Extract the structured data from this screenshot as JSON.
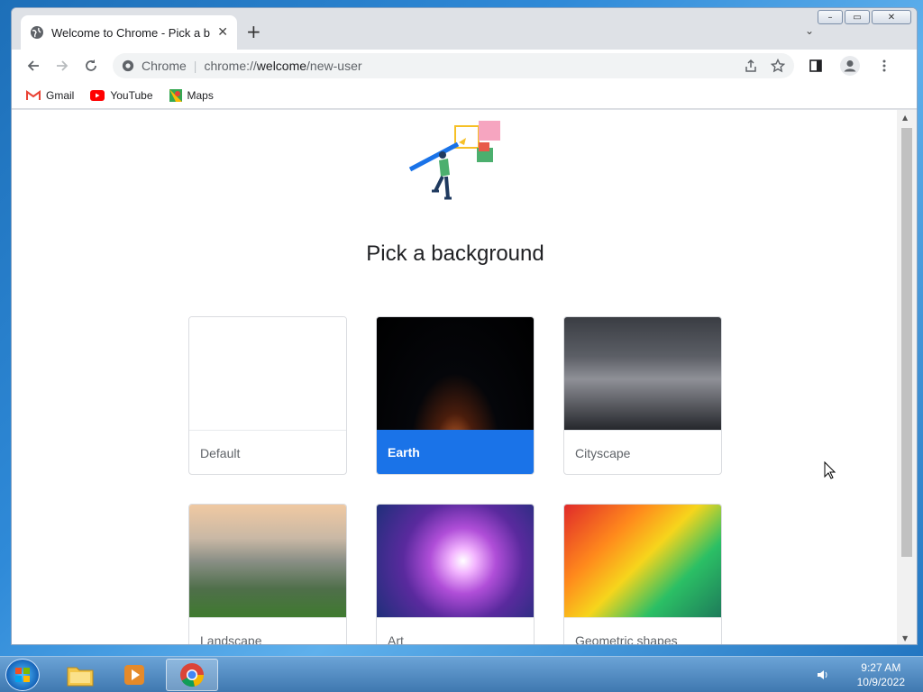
{
  "tab": {
    "title": "Welcome to Chrome - Pick a background"
  },
  "omnibox": {
    "site": "Chrome",
    "url_prefix": "chrome://",
    "url_host": "welcome",
    "url_path": "/new-user"
  },
  "bookmarks": [
    {
      "label": "Gmail",
      "icon": "gmail-icon"
    },
    {
      "label": "YouTube",
      "icon": "youtube-icon"
    },
    {
      "label": "Maps",
      "icon": "maps-icon"
    }
  ],
  "page": {
    "heading": "Pick a background",
    "backgrounds": [
      {
        "label": "Default",
        "selected": false
      },
      {
        "label": "Earth",
        "selected": true
      },
      {
        "label": "Cityscape",
        "selected": false
      },
      {
        "label": "Landscape",
        "selected": false
      },
      {
        "label": "Art",
        "selected": false
      },
      {
        "label": "Geometric shapes",
        "selected": false
      }
    ]
  },
  "taskbar": {
    "time": "9:27 AM",
    "date": "10/9/2022"
  },
  "colors": {
    "accent": "#1a73e8"
  }
}
